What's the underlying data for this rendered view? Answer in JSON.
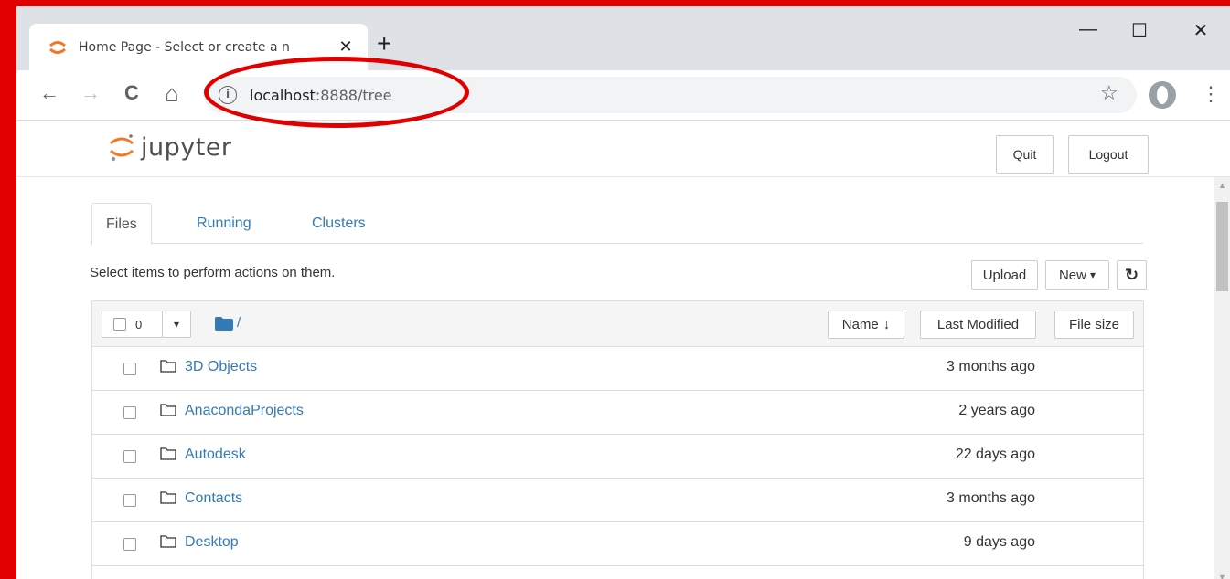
{
  "browser": {
    "tab_title": "Home Page - Select or create a n",
    "tab_close": "✕",
    "new_tab": "+",
    "window_min": "—",
    "window_max": "☐",
    "window_close": "✕",
    "url_host": "localhost",
    "url_rest": ":8888/tree",
    "info_glyph": "i",
    "star_glyph": "☆",
    "menu_glyph": "⋮",
    "back_glyph": "←",
    "forward_glyph": "→",
    "reload_glyph": "C",
    "home_glyph": "⌂"
  },
  "jupyter": {
    "logo_text": "jupyter",
    "quit_label": "Quit",
    "logout_label": "Logout",
    "tabs": [
      {
        "label": "Files"
      },
      {
        "label": "Running"
      },
      {
        "label": "Clusters"
      }
    ],
    "hint": "Select items to perform actions on them.",
    "upload_label": "Upload",
    "new_label": "New",
    "dropdown_glyph": "▾",
    "refresh_glyph": "↻",
    "selected_count": "0",
    "breadcrumb_path": "/",
    "columns": {
      "name": "Name",
      "name_sort_glyph": "↓",
      "last_modified": "Last Modified",
      "file_size": "File size"
    },
    "files": [
      {
        "name": "3D Objects",
        "modified": "3 months ago"
      },
      {
        "name": "AnacondaProjects",
        "modified": "2 years ago"
      },
      {
        "name": "Autodesk",
        "modified": "22 days ago"
      },
      {
        "name": "Contacts",
        "modified": "3 months ago"
      },
      {
        "name": "Desktop",
        "modified": "9 days ago"
      }
    ]
  },
  "colors": {
    "accent_link": "#337ab7",
    "annotation_red": "#e00000",
    "jupyter_orange": "#f37726"
  }
}
